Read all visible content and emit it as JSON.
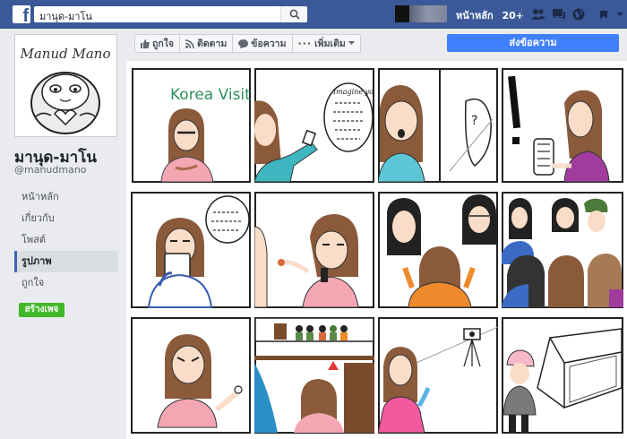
{
  "topbar": {
    "search_value": "มานุด-มาโน",
    "home_label": "หน้าหลัก",
    "notif_count": "20+"
  },
  "page": {
    "name": "มานุด-มาโน",
    "handle": "@manudmano",
    "logo_text": "Manud Mano"
  },
  "sidebar": {
    "items": [
      {
        "label": "หน้าหลัก"
      },
      {
        "label": "เกี่ยวกับ"
      },
      {
        "label": "โพสต์"
      },
      {
        "label": "รูปภาพ",
        "active": true
      },
      {
        "label": "ถูกใจ"
      }
    ],
    "create_page_label": "สร้างเพจ"
  },
  "actions": {
    "like_label": "ถูกใจ",
    "follow_label": "ติดตาม",
    "message_label": "ข้อความ",
    "more_label": "เพิ่มเติม",
    "send_message_label": "ส่งข้อความ"
  },
  "comics": {
    "korea_visit": "Korea Visit",
    "bubble_text": "Imagine you"
  },
  "colors": {
    "fb_blue": "#3b5998",
    "send_blue": "#4080ff",
    "create_green": "#42b72a"
  }
}
